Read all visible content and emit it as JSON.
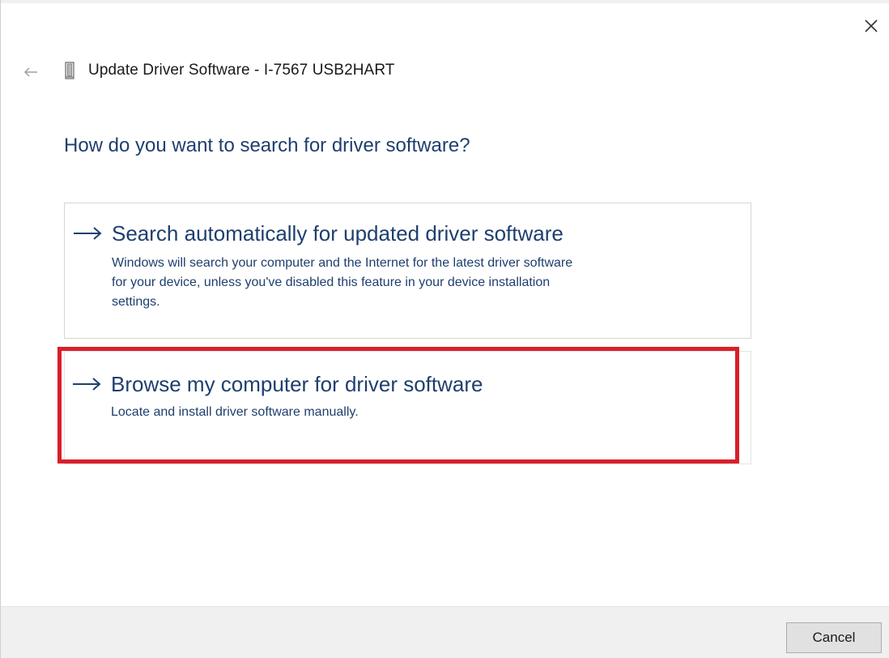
{
  "window": {
    "title": "Update Driver Software - I-7567 USB2HART",
    "heading": "How do you want to search for driver software?"
  },
  "icons": {
    "close": "close-icon",
    "back": "back-arrow-icon",
    "device": "usb-device-icon",
    "option_arrow": "right-arrow-icon"
  },
  "options": [
    {
      "label": "Search automatically for updated driver software",
      "description_lines": [
        "Windows will search your computer and the Internet for the latest driver software",
        "for your device, unless you've disabled this feature in your device installation",
        "settings."
      ]
    },
    {
      "label": "Browse my computer for driver software",
      "description_lines": [
        "Locate and install driver software manually."
      ],
      "highlighted": true
    }
  ],
  "footer": {
    "cancel_label": "Cancel"
  },
  "colors": {
    "link_blue": "#1e3f6e",
    "highlight_red": "#d91f2a",
    "footer_bg": "#f0f0f0"
  }
}
